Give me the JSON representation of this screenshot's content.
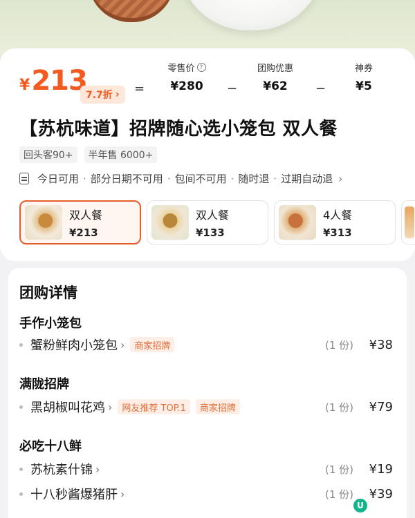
{
  "price": {
    "currency": "¥",
    "amount": "213",
    "discount_label": "7.7折",
    "equals": "=",
    "minus": "−",
    "retail": {
      "label": "零售价",
      "value": "¥280"
    },
    "group": {
      "label": "团购优惠",
      "value": "¥62"
    },
    "coupon": {
      "label": "神券",
      "value": "¥5"
    }
  },
  "title": "【苏杭味道】招牌随心选小笼包 双人餐",
  "tags": [
    "回头客90+",
    "半年售 6000+"
  ],
  "rules": [
    "今日可用",
    "部分日期不可用",
    "包间不可用",
    "随时退",
    "过期自动退"
  ],
  "packages": [
    {
      "name": "双人餐",
      "price": "¥213",
      "selected": true
    },
    {
      "name": "双人餐",
      "price": "¥133",
      "selected": false
    },
    {
      "name": "4人餐",
      "price": "¥313",
      "selected": false
    }
  ],
  "details": {
    "title": "团购详情",
    "sections": [
      {
        "title": "手作小笼包",
        "items": [
          {
            "name": "蟹粉鲜肉小笼包",
            "badges": [
              "商家招牌"
            ],
            "qty": "(1 份)",
            "price": "¥38"
          }
        ]
      },
      {
        "title": "满陇招牌",
        "items": [
          {
            "name": "黑胡椒叫花鸡",
            "badges": [
              "网友推荐 TOP.1",
              "商家招牌"
            ],
            "qty": "(1 份)",
            "price": "¥79"
          }
        ]
      },
      {
        "title": "必吃十八鲜",
        "items": [
          {
            "name": "苏杭素什锦",
            "badges": [],
            "qty": "(1 份)",
            "price": "¥19"
          },
          {
            "name": "十八秒酱爆猪肝",
            "badges": [],
            "qty": "(1 份)",
            "price": "¥39"
          }
        ]
      }
    ]
  },
  "icons": {
    "help": "help-circle-icon",
    "doc": "document-icon",
    "chevron": "chevron-right-icon",
    "app_badge": "app-logo-icon"
  },
  "colors": {
    "accent": "#f25a1f",
    "badge_bg": "#fdeee6",
    "badge_text": "#e46d3b",
    "selected_border": "#e65c2a"
  }
}
